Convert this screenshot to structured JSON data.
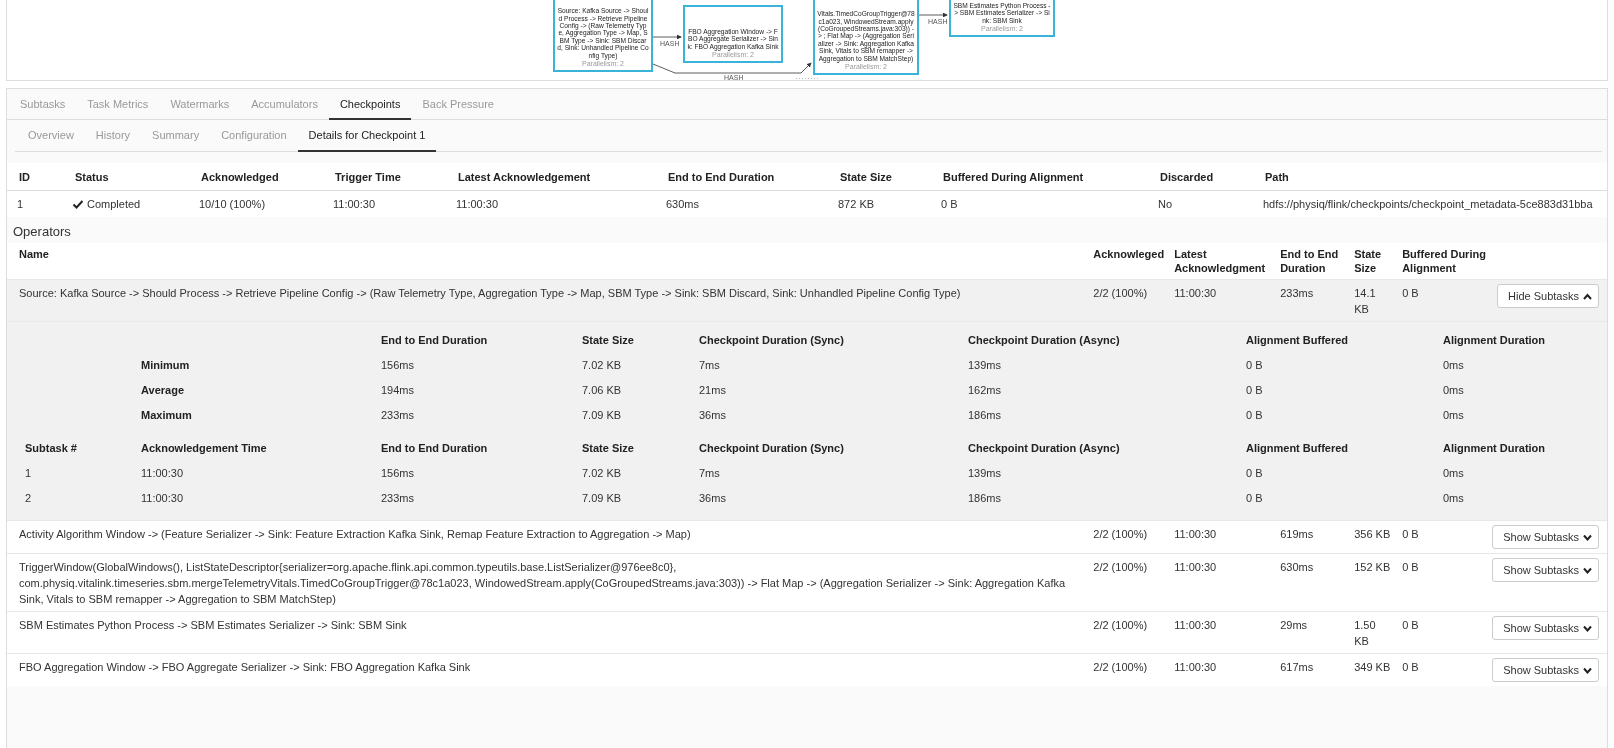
{
  "graph": {
    "nodes": [
      {
        "text": "Source: Kafka Source -> Should Process -> Retrieve Pipeline Config -> (Raw Telemetry Type, Aggregation Type -> Map, SBM Type -> Sink: SBM Discard, Sink: Unhandled Pipeline Config Type)",
        "parallelism": "Parallelism: 2"
      },
      {
        "text": "FBO Aggregation Window -> FBO Aggregate Serializer -> Sink: FBO Aggregation Kafka Sink",
        "parallelism": "Parallelism: 2"
      },
      {
        "text": "Vitals.TimedCoGroupTrigger@78c1a023, WindowedStream.apply(CoGroupedStreams.java:303)) -> ; Flat Map -> (Aggregation Serializer -> Sink: Aggregation Kafka Sink, Vitals to SBM remapper -> Aggregation to SBM MatchStep)",
        "parallelism": "Parallelism: 2"
      },
      {
        "text": "SBM Estimates Python Process -> SBM Estimates Serializer -> Sink: SBM Sink",
        "parallelism": "Parallelism: 2"
      }
    ],
    "edges": [
      {
        "label": "HASH"
      },
      {
        "label": "HASH"
      },
      {
        "label": "HASH"
      }
    ]
  },
  "job_tabs": [
    {
      "label": "Subtasks",
      "selected": false
    },
    {
      "label": "Task Metrics",
      "selected": false
    },
    {
      "label": "Watermarks",
      "selected": false
    },
    {
      "label": "Accumulators",
      "selected": false
    },
    {
      "label": "Checkpoints",
      "selected": true
    },
    {
      "label": "Back Pressure",
      "selected": false
    }
  ],
  "checkpoint_tabs": [
    {
      "label": "Overview",
      "selected": false
    },
    {
      "label": "History",
      "selected": false
    },
    {
      "label": "Summary",
      "selected": false
    },
    {
      "label": "Configuration",
      "selected": false
    },
    {
      "label": "Details for Checkpoint 1",
      "selected": true
    }
  ],
  "checkpoint": {
    "columns": [
      "ID",
      "Status",
      "Acknowledged",
      "Trigger Time",
      "Latest Acknowledgement",
      "End to End Duration",
      "State Size",
      "Buffered During Alignment",
      "Discarded",
      "Path"
    ],
    "row": [
      {
        "kind": "text",
        "text": "1"
      },
      {
        "kind": "status",
        "text": "Completed"
      },
      {
        "kind": "text",
        "text": "10/10 (100%)"
      },
      {
        "kind": "text",
        "text": "11:00:30"
      },
      {
        "kind": "text",
        "text": "11:00:30"
      },
      {
        "kind": "text",
        "text": "630ms"
      },
      {
        "kind": "text",
        "text": "872 KB"
      },
      {
        "kind": "text",
        "text": "0 B"
      },
      {
        "kind": "text",
        "text": "No"
      },
      {
        "kind": "text",
        "text": "hdfs://physiq/flink/checkpoints/checkpoint_metadata-5ce883d31bba"
      }
    ]
  },
  "operators": {
    "title": "Operators",
    "columns": [
      "Name",
      "Acknowleged",
      "Latest Acknowledgment",
      "End to End Duration",
      "State Size",
      "Buffered During Alignment"
    ],
    "rows": [
      {
        "cells": [
          "Source: Kafka Source -> Should Process -> Retrieve Pipeline Config -> (Raw Telemetry Type, Aggregation Type -> Map, SBM Type -> Sink: SBM Discard, Sink: Unhandled Pipeline Config Type)",
          "2/2 (100%)",
          "11:00:30",
          "233ms",
          "14.1 KB",
          "0 B"
        ],
        "button": "Hide Subtasks",
        "expanded": true,
        "stats": {
          "columns": [
            "End to End Duration",
            "State Size",
            "Checkpoint Duration (Sync)",
            "Checkpoint Duration (Async)",
            "Alignment Buffered",
            "Alignment Duration"
          ],
          "rows": [
            {
              "label": "Minimum",
              "values": [
                "156ms",
                "7.02 KB",
                "7ms",
                "139ms",
                "0 B",
                "0ms"
              ]
            },
            {
              "label": "Average",
              "values": [
                "194ms",
                "7.06 KB",
                "21ms",
                "162ms",
                "0 B",
                "0ms"
              ]
            },
            {
              "label": "Maximum",
              "values": [
                "233ms",
                "7.09 KB",
                "36ms",
                "186ms",
                "0 B",
                "0ms"
              ]
            }
          ]
        },
        "subtasks": {
          "columns": [
            "Subtask #",
            "Acknowledgement Time",
            "End to End Duration",
            "State Size",
            "Checkpoint Duration (Sync)",
            "Checkpoint Duration (Async)",
            "Alignment Buffered",
            "Alignment Duration"
          ],
          "rows": [
            [
              "1",
              "11:00:30",
              "156ms",
              "7.02 KB",
              "7ms",
              "139ms",
              "0 B",
              "0ms"
            ],
            [
              "2",
              "11:00:30",
              "233ms",
              "7.09 KB",
              "36ms",
              "186ms",
              "0 B",
              "0ms"
            ]
          ]
        }
      },
      {
        "cells": [
          "Activity Algorithm Window -> (Feature Serializer -> Sink: Feature Extraction Kafka Sink, Remap Feature Extraction to Aggregation -> Map)",
          "2/2 (100%)",
          "11:00:30",
          "619ms",
          "356 KB",
          "0 B"
        ],
        "button": "Show Subtasks",
        "expanded": false
      },
      {
        "cells": [
          "TriggerWindow(GlobalWindows(), ListStateDescriptor{serializer=org.apache.flink.api.common.typeutils.base.ListSerializer@976ee8c0}, com.physiq.vitalink.timeseries.sbm.mergeTelemetryVitals.TimedCoGroupTrigger@78c1a023, WindowedStream.apply(CoGroupedStreams.java:303)) -> Flat Map -> (Aggregation Serializer -> Sink: Aggregation Kafka Sink, Vitals to SBM remapper -> Aggregation to SBM MatchStep)",
          "2/2 (100%)",
          "11:00:30",
          "630ms",
          "152 KB",
          "0 B"
        ],
        "button": "Show Subtasks",
        "expanded": false
      },
      {
        "cells": [
          "SBM Estimates Python Process -> SBM Estimates Serializer -> Sink: SBM Sink",
          "2/2 (100%)",
          "11:00:30",
          "29ms",
          "1.50 KB",
          "0 B"
        ],
        "button": "Show Subtasks",
        "expanded": false
      },
      {
        "cells": [
          "FBO Aggregation Window -> FBO Aggregate Serializer -> Sink: FBO Aggregation Kafka Sink",
          "2/2 (100%)",
          "11:00:30",
          "617ms",
          "349 KB",
          "0 B"
        ],
        "button": "Show Subtasks",
        "expanded": false
      }
    ]
  }
}
